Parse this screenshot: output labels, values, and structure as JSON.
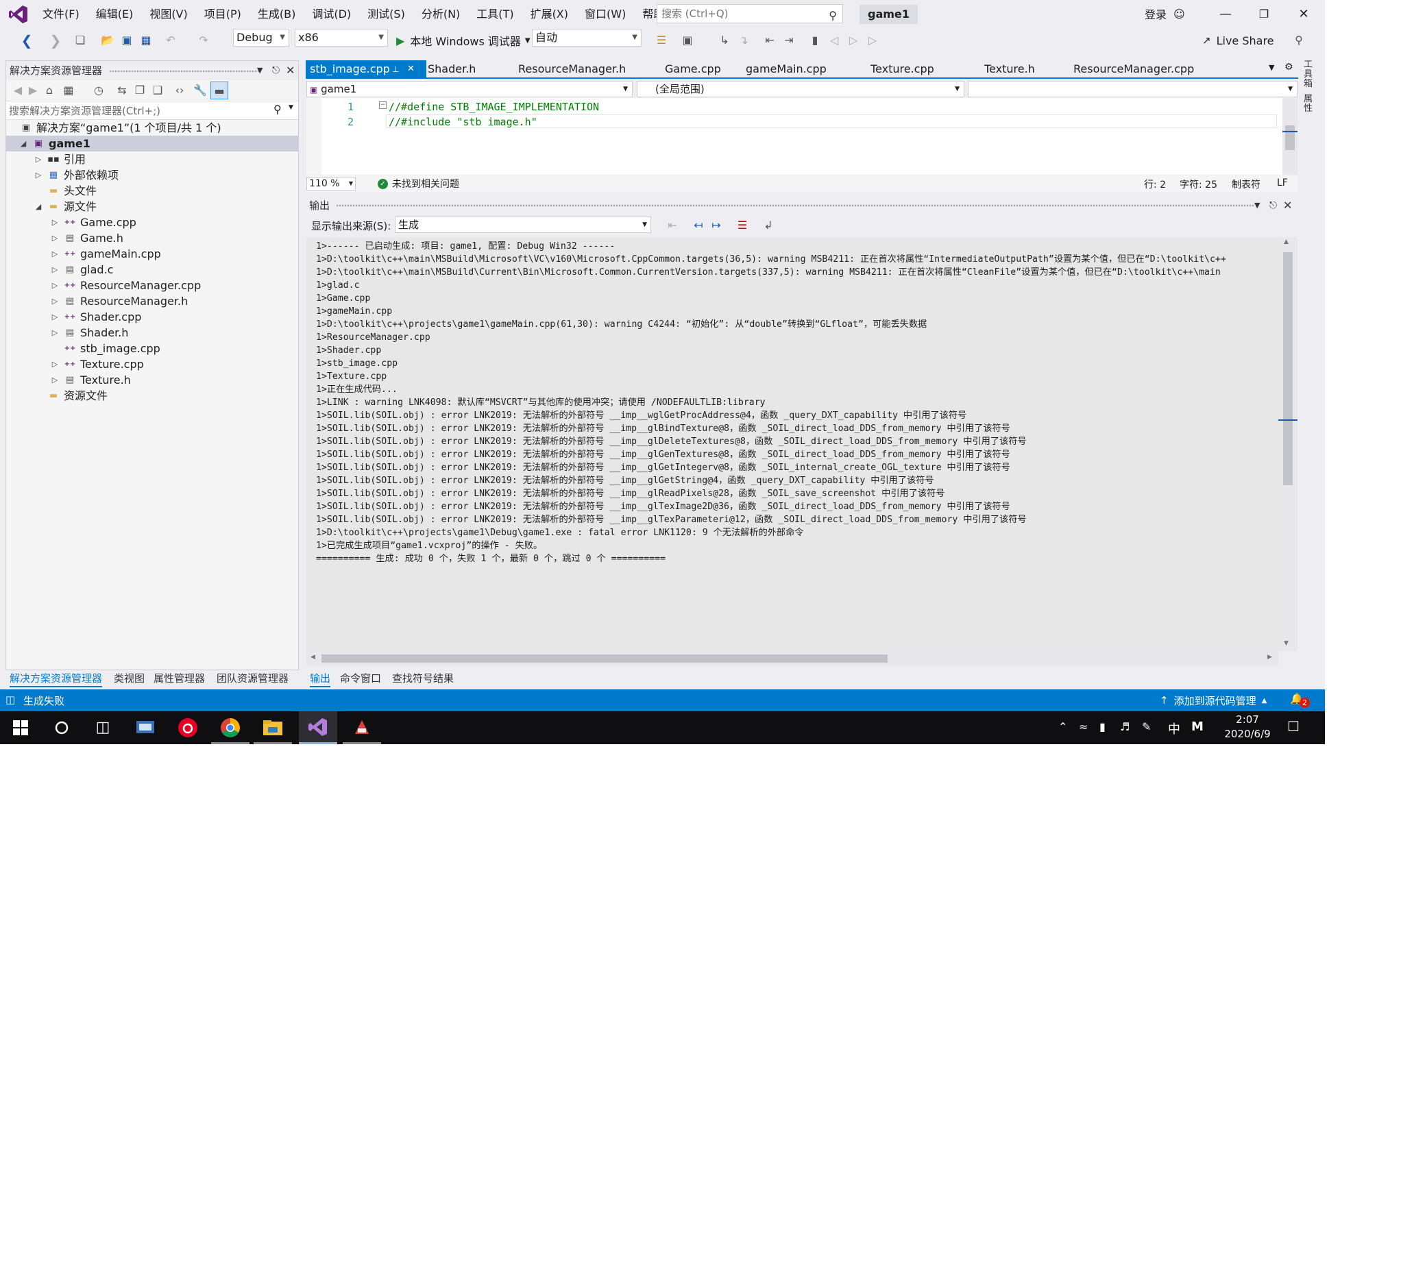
{
  "titlebar": {
    "menu": [
      "文件(F)",
      "编辑(E)",
      "视图(V)",
      "项目(P)",
      "生成(B)",
      "调试(D)",
      "测试(S)",
      "分析(N)",
      "工具(T)",
      "扩展(X)",
      "窗口(W)",
      "帮助(H)"
    ],
    "search_placeholder": "搜索 (Ctrl+Q)",
    "solution_name": "game1",
    "login": "登录"
  },
  "toolbar": {
    "config": "Debug",
    "platform": "x86",
    "run_label": "本地 Windows 调试器",
    "auto": "自动",
    "live_share": "Live Share"
  },
  "solution_explorer": {
    "title": "解决方案资源管理器",
    "search_placeholder": "搜索解决方案资源管理器(Ctrl+;)",
    "tree": [
      {
        "label": "解决方案“game1”(1 个项目/共 1 个)",
        "level": 0,
        "arrow": "",
        "icon": "solution-icon"
      },
      {
        "label": "game1",
        "level": 1,
        "arrow": "expanded",
        "icon": "project-icon",
        "selected": true,
        "bold": true
      },
      {
        "label": "引用",
        "level": 2,
        "arrow": "collapsed",
        "icon": "references-icon"
      },
      {
        "label": "外部依赖项",
        "level": 2,
        "arrow": "collapsed",
        "icon": "external-deps-icon"
      },
      {
        "label": "头文件",
        "level": 2,
        "arrow": "",
        "icon": "folder-icon"
      },
      {
        "label": "源文件",
        "level": 2,
        "arrow": "expanded",
        "icon": "folder-open-icon"
      },
      {
        "label": "Game.cpp",
        "level": 3,
        "arrow": "collapsed",
        "icon": "cpp-file-icon"
      },
      {
        "label": "Game.h",
        "level": 3,
        "arrow": "collapsed",
        "icon": "header-file-icon"
      },
      {
        "label": "gameMain.cpp",
        "level": 3,
        "arrow": "collapsed",
        "icon": "cpp-file-icon"
      },
      {
        "label": "glad.c",
        "level": 3,
        "arrow": "collapsed",
        "icon": "c-file-icon"
      },
      {
        "label": "ResourceManager.cpp",
        "level": 3,
        "arrow": "collapsed",
        "icon": "cpp-file-icon"
      },
      {
        "label": "ResourceManager.h",
        "level": 3,
        "arrow": "collapsed",
        "icon": "header-file-icon"
      },
      {
        "label": "Shader.cpp",
        "level": 3,
        "arrow": "collapsed",
        "icon": "cpp-file-icon"
      },
      {
        "label": "Shader.h",
        "level": 3,
        "arrow": "collapsed",
        "icon": "header-file-icon"
      },
      {
        "label": "stb_image.cpp",
        "level": 3,
        "arrow": "",
        "icon": "cpp-file-icon"
      },
      {
        "label": "Texture.cpp",
        "level": 3,
        "arrow": "collapsed",
        "icon": "cpp-file-icon"
      },
      {
        "label": "Texture.h",
        "level": 3,
        "arrow": "collapsed",
        "icon": "header-file-icon"
      },
      {
        "label": "资源文件",
        "level": 2,
        "arrow": "",
        "icon": "folder-icon"
      }
    ],
    "bottom_tabs": [
      "解决方案资源管理器",
      "类视图",
      "属性管理器",
      "团队资源管理器"
    ]
  },
  "editor": {
    "tabs": [
      "stb_image.cpp",
      "Shader.h",
      "ResourceManager.h",
      "Game.cpp",
      "gameMain.cpp",
      "Texture.cpp",
      "Texture.h",
      "ResourceManager.cpp"
    ],
    "nav_project": "game1",
    "nav_scope": "(全局范围)",
    "lines": [
      {
        "num": "1",
        "text": "//#define STB_IMAGE_IMPLEMENTATION"
      },
      {
        "num": "2",
        "text": "//#include \"stb_image.h\""
      }
    ],
    "zoom": "110 %",
    "issues": "未找到相关问题",
    "row": "行: 2",
    "col": "字符: 25",
    "tabs_mode": "制表符",
    "eol": "LF"
  },
  "side_tabs": [
    "工具箱",
    "属性"
  ],
  "output": {
    "title": "输出",
    "source_label": "显示输出来源(S):",
    "source_value": "生成",
    "lines": [
      "1>------ 已启动生成: 项目: game1, 配置: Debug Win32 ------",
      "1>D:\\toolkit\\c++\\main\\MSBuild\\Microsoft\\VC\\v160\\Microsoft.CppCommon.targets(36,5): warning MSB4211: 正在首次将属性“IntermediateOutputPath”设置为某个值，但已在“D:\\toolkit\\c++",
      "1>D:\\toolkit\\c++\\main\\MSBuild\\Current\\Bin\\Microsoft.Common.CurrentVersion.targets(337,5): warning MSB4211: 正在首次将属性“CleanFile”设置为某个值，但已在“D:\\toolkit\\c++\\main",
      "1>glad.c",
      "1>Game.cpp",
      "1>gameMain.cpp",
      "1>D:\\toolkit\\c++\\projects\\game1\\gameMain.cpp(61,30): warning C4244: “初始化”: 从“double”转换到“GLfloat”，可能丢失数据",
      "1>ResourceManager.cpp",
      "1>Shader.cpp",
      "1>stb_image.cpp",
      "1>Texture.cpp",
      "1>正在生成代码...",
      "1>LINK : warning LNK4098: 默认库“MSVCRT”与其他库的使用冲突；请使用 /NODEFAULTLIB:library",
      "1>SOIL.lib(SOIL.obj) : error LNK2019: 无法解析的外部符号 __imp__wglGetProcAddress@4，函数 _query_DXT_capability 中引用了该符号",
      "1>SOIL.lib(SOIL.obj) : error LNK2019: 无法解析的外部符号 __imp__glBindTexture@8，函数 _SOIL_direct_load_DDS_from_memory 中引用了该符号",
      "1>SOIL.lib(SOIL.obj) : error LNK2019: 无法解析的外部符号 __imp__glDeleteTextures@8，函数 _SOIL_direct_load_DDS_from_memory 中引用了该符号",
      "1>SOIL.lib(SOIL.obj) : error LNK2019: 无法解析的外部符号 __imp__glGenTextures@8，函数 _SOIL_direct_load_DDS_from_memory 中引用了该符号",
      "1>SOIL.lib(SOIL.obj) : error LNK2019: 无法解析的外部符号 __imp__glGetIntegerv@8，函数 _SOIL_internal_create_OGL_texture 中引用了该符号",
      "1>SOIL.lib(SOIL.obj) : error LNK2019: 无法解析的外部符号 __imp__glGetString@4，函数 _query_DXT_capability 中引用了该符号",
      "1>SOIL.lib(SOIL.obj) : error LNK2019: 无法解析的外部符号 __imp__glReadPixels@28，函数 _SOIL_save_screenshot 中引用了该符号",
      "1>SOIL.lib(SOIL.obj) : error LNK2019: 无法解析的外部符号 __imp__glTexImage2D@36，函数 _SOIL_direct_load_DDS_from_memory 中引用了该符号",
      "1>SOIL.lib(SOIL.obj) : error LNK2019: 无法解析的外部符号 __imp__glTexParameteri@12，函数 _SOIL_direct_load_DDS_from_memory 中引用了该符号",
      "1>D:\\toolkit\\c++\\projects\\game1\\Debug\\game1.exe : fatal error LNK1120: 9 个无法解析的外部命令",
      "1>已完成生成项目“game1.vcxproj”的操作 - 失败。",
      "========== 生成: 成功 0 个，失败 1 个，最新 0 个，跳过 0 个 =========="
    ],
    "bottom_tabs": [
      "输出",
      "命令窗口",
      "查找符号结果"
    ]
  },
  "statusbar": {
    "message": "生成失败",
    "source_control": "添加到源代码管理",
    "notifications": "2"
  },
  "taskbar": {
    "time": "2:07",
    "date": "2020/6/9",
    "ime": "中",
    "ime_mode": "M"
  },
  "colors": {
    "accent": "#007acc",
    "taskbar": "#0f0f12",
    "vs_purple": "#68217a"
  }
}
